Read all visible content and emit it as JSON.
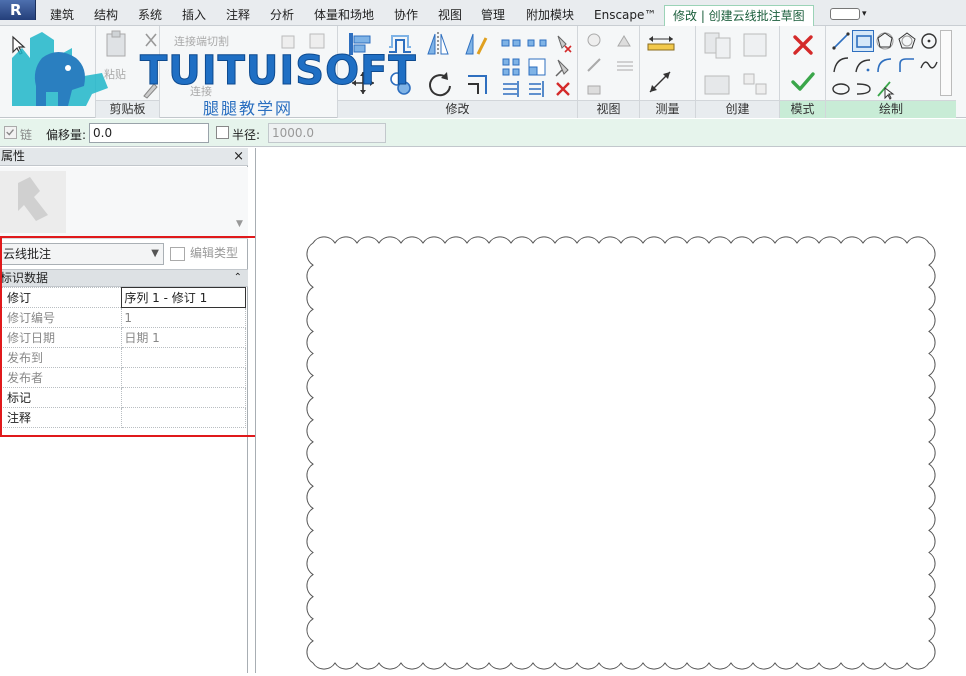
{
  "tabs": [
    {
      "label": "建筑",
      "active": false
    },
    {
      "label": "结构",
      "active": false
    },
    {
      "label": "系统",
      "active": false
    },
    {
      "label": "插入",
      "active": false
    },
    {
      "label": "注释",
      "active": false
    },
    {
      "label": "分析",
      "active": false
    },
    {
      "label": "体量和场地",
      "active": false
    },
    {
      "label": "协作",
      "active": false
    },
    {
      "label": "视图",
      "active": false
    },
    {
      "label": "管理",
      "active": false
    },
    {
      "label": "附加模块",
      "active": false
    },
    {
      "label": "Enscape™",
      "active": false
    },
    {
      "label": "修改 | 创建云线批注草图",
      "active": true
    }
  ],
  "ribbon": {
    "panels": {
      "clipboard": "剪贴板",
      "modify": "修改",
      "view": "视图",
      "measure": "测量",
      "create": "创建",
      "mode": "模式",
      "draw": "绘制"
    },
    "clipboard_paste": "粘贴",
    "geometry_items": [
      "连接端切割",
      "连接",
      "剪切"
    ]
  },
  "watermark": {
    "brand": "TUITUISOFT",
    "subtitle": "腿腿教学网"
  },
  "options_bar": {
    "chain_label": "链",
    "chain_checked": true,
    "offset_label": "偏移量:",
    "offset_value": "0.0",
    "radius_label": "半径:",
    "radius_checked": false,
    "radius_value": "1000.0"
  },
  "properties": {
    "title": "属性",
    "close": "×",
    "type_name": "云线批注",
    "edit_type": "编辑类型",
    "section": "标识数据",
    "rows": [
      {
        "name": "修订",
        "value": "序列 1 - 修订 1",
        "dim": false
      },
      {
        "name": "修订编号",
        "value": "1",
        "dim": true
      },
      {
        "name": "修订日期",
        "value": "日期 1",
        "dim": true
      },
      {
        "name": "发布到",
        "value": "",
        "dim": true
      },
      {
        "name": "发布者",
        "value": "",
        "dim": true
      },
      {
        "name": "标记",
        "value": "",
        "dim": false
      },
      {
        "name": "注释",
        "value": "",
        "dim": false
      }
    ]
  },
  "colors": {
    "active_tab_border": "#9bd3b7",
    "highlight": "#e0191b",
    "cancel_x": "#d42a2a",
    "finish_check": "#3aa64a"
  }
}
